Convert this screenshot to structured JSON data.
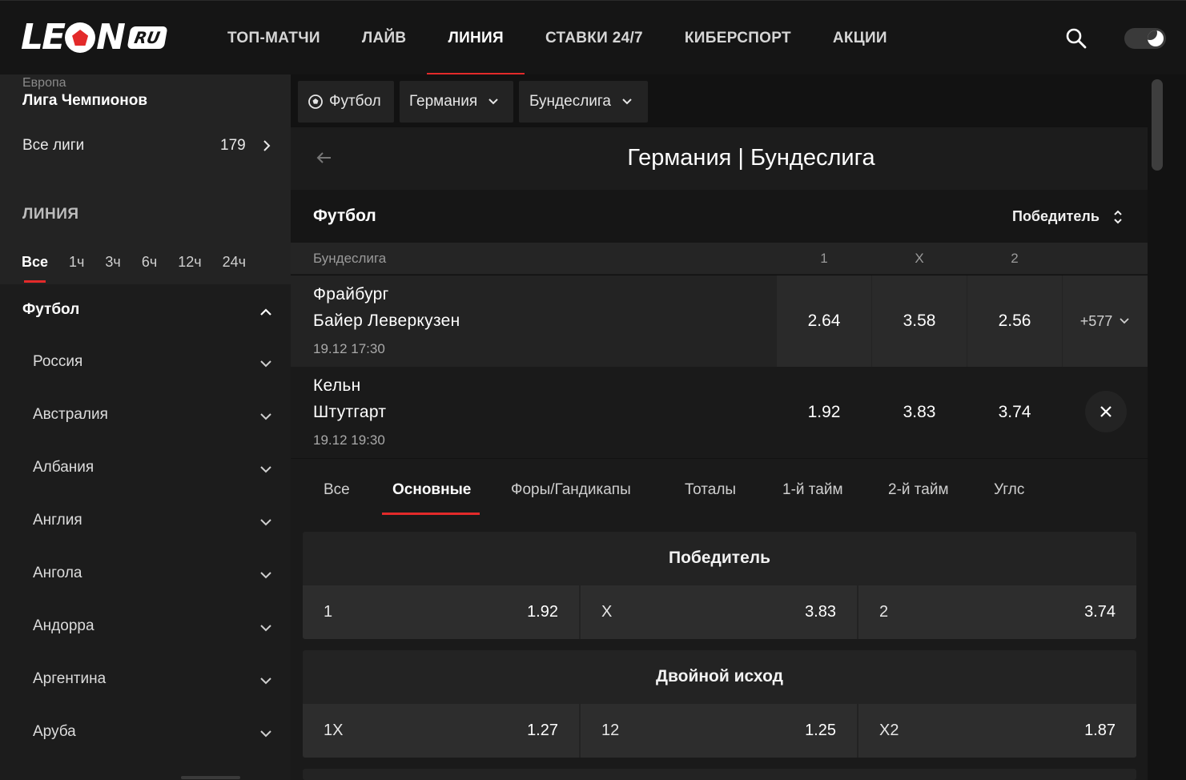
{
  "header": {
    "logo_text_a": "LE",
    "logo_text_b": "N",
    "logo_ru": "RU",
    "nav": [
      "ТОП-МАТЧИ",
      "ЛАЙВ",
      "ЛИНИЯ",
      "СТАВКИ 24/7",
      "КИБЕРСПОРТ",
      "АКЦИИ"
    ],
    "active_nav": "ЛИНИЯ",
    "accent_color": "#e32a2a"
  },
  "sidebar": {
    "region": "Европа",
    "league": "Лига Чемпионов",
    "all_leagues_label": "Все лиги",
    "all_leagues_count": "179",
    "section_title": "ЛИНИЯ",
    "filters": [
      "Все",
      "1ч",
      "3ч",
      "6ч",
      "12ч",
      "24ч"
    ],
    "active_filter": "Все",
    "sport": "Футбол",
    "countries": [
      "Россия",
      "Австралия",
      "Албания",
      "Англия",
      "Ангола",
      "Андорра",
      "Аргентина",
      "Аруба"
    ]
  },
  "breadcrumbs": {
    "sport": "Футбол",
    "country": "Германия",
    "league": "Бундеслига"
  },
  "page_title": "Германия | Бундеслига",
  "sport_header": {
    "title": "Футбол",
    "market_select": "Победитель"
  },
  "league_header": {
    "name": "Бундеслига",
    "col1": "1",
    "colx": "X",
    "col2": "2"
  },
  "matches": [
    {
      "home": "Фрайбург",
      "away": "Байер Леверкузен",
      "time": "19.12 17:30",
      "o1": "2.64",
      "ox": "3.58",
      "o2": "2.56",
      "more": "+577"
    },
    {
      "home": "Кельн",
      "away": "Штутгарт",
      "time": "19.12 19:30",
      "o1": "1.92",
      "ox": "3.83",
      "o2": "3.74"
    }
  ],
  "tabs": [
    "Все",
    "Основные",
    "Форы/Гандикапы",
    "Тоталы",
    "1-й тайм",
    "2-й тайм",
    "Углс"
  ],
  "active_tab": "Основные",
  "markets": [
    {
      "title": "Победитель",
      "selections": [
        {
          "label": "1",
          "odd": "1.92"
        },
        {
          "label": "X",
          "odd": "3.83"
        },
        {
          "label": "2",
          "odd": "3.74"
        }
      ]
    },
    {
      "title": "Двойной исход",
      "selections": [
        {
          "label": "1X",
          "odd": "1.27"
        },
        {
          "label": "12",
          "odd": "1.25"
        },
        {
          "label": "X2",
          "odd": "1.87"
        }
      ]
    }
  ]
}
